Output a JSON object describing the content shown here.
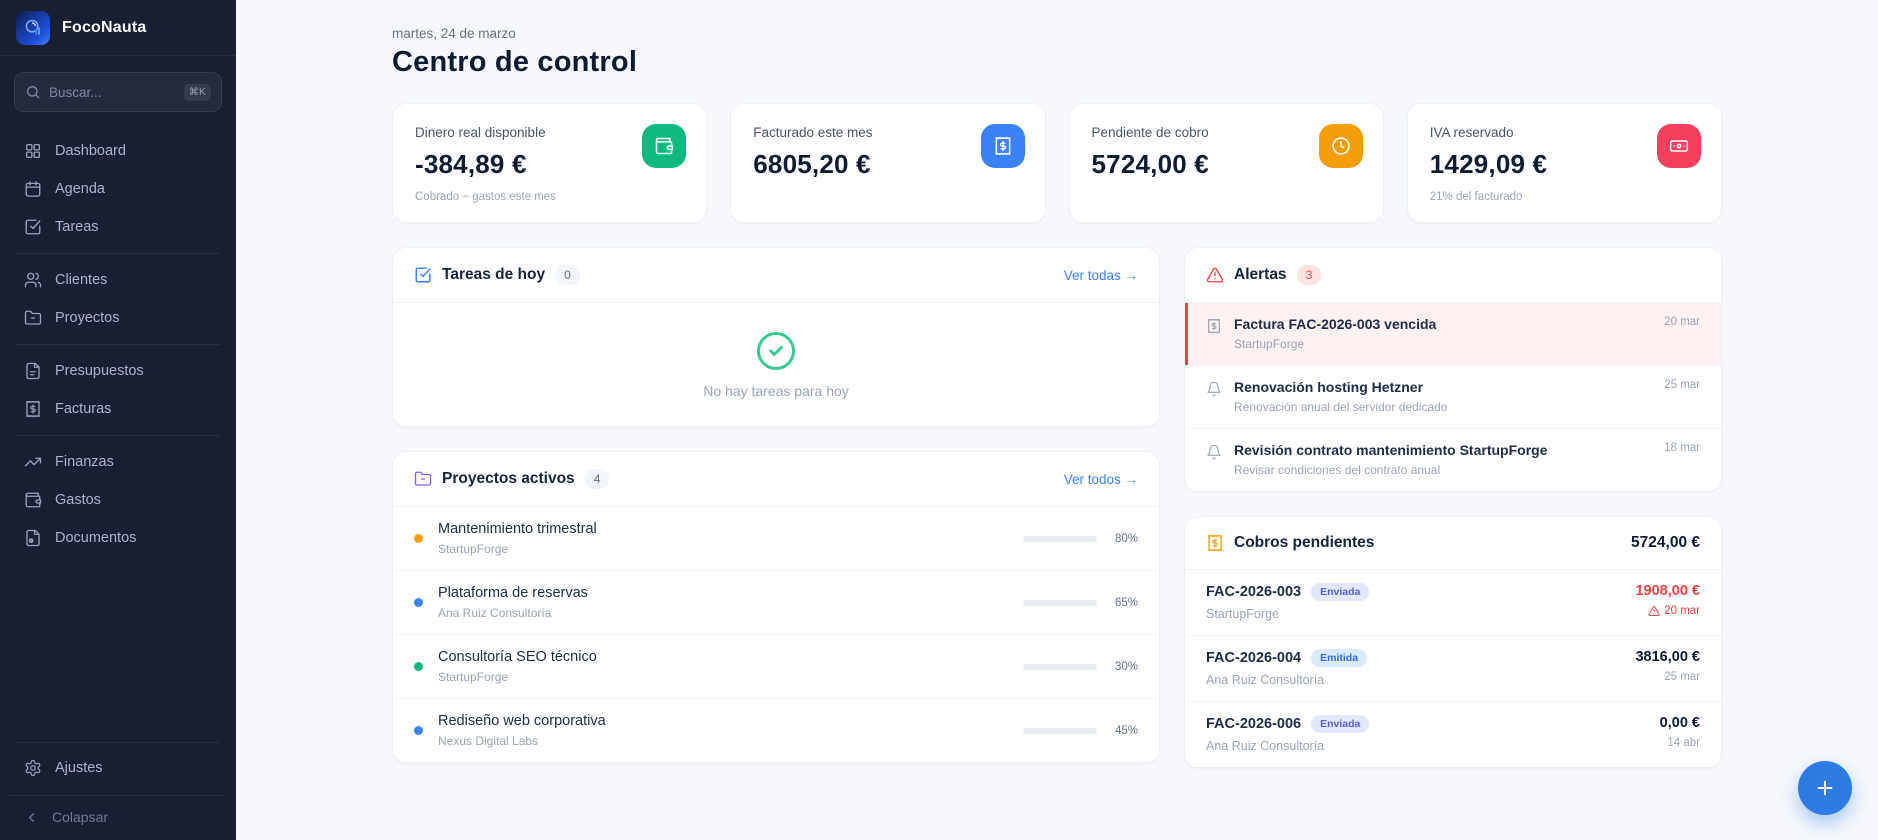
{
  "app": {
    "name": "FocoNauta"
  },
  "sidebar": {
    "search": {
      "placeholder": "Buscar...",
      "shortcut": "⌘K"
    },
    "items": [
      {
        "label": "Dashboard",
        "icon": "dashboard-icon"
      },
      {
        "label": "Agenda",
        "icon": "calendar-icon"
      },
      {
        "label": "Tareas",
        "icon": "check-square-icon"
      },
      {
        "label": "Clientes",
        "icon": "users-icon",
        "divider_before": true
      },
      {
        "label": "Proyectos",
        "icon": "folder-icon"
      },
      {
        "label": "Presupuestos",
        "icon": "file-text-icon",
        "divider_before": true
      },
      {
        "label": "Facturas",
        "icon": "receipt-icon"
      },
      {
        "label": "Finanzas",
        "icon": "trending-up-icon",
        "divider_before": true
      },
      {
        "label": "Gastos",
        "icon": "wallet-icon"
      },
      {
        "label": "Documentos",
        "icon": "document-icon"
      }
    ],
    "settings_label": "Ajustes",
    "collapse_label": "Colapsar"
  },
  "header": {
    "date": "martes, 24 de marzo",
    "title": "Centro de control"
  },
  "stats": [
    {
      "label": "Dinero real disponible",
      "value": "-384,89 €",
      "sub": "Cobrado − gastos este mes",
      "icon": "wallet-icon",
      "color": "#10b981"
    },
    {
      "label": "Facturado este mes",
      "value": "6805,20 €",
      "sub": "",
      "icon": "receipt-icon",
      "color": "#3b82f6"
    },
    {
      "label": "Pendiente de cobro",
      "value": "5724,00 €",
      "sub": "",
      "icon": "clock-icon",
      "color": "#f59e0b"
    },
    {
      "label": "IVA reservado",
      "value": "1429,09 €",
      "sub": "21% del facturado",
      "icon": "banknote-icon",
      "color": "#f43f5e"
    }
  ],
  "tasks": {
    "title": "Tareas de hoy",
    "count": "0",
    "link_label": "Ver todas →",
    "empty_text": "No hay tareas para hoy"
  },
  "projects": {
    "title": "Proyectos activos",
    "count": "4",
    "link_label": "Ver todos →",
    "items": [
      {
        "name": "Mantenimiento trimestral",
        "client": "StartupForge",
        "progress": 80,
        "progress_label": "80%",
        "dot_color": "#f59e0b"
      },
      {
        "name": "Plataforma de reservas",
        "client": "Ana Ruiz Consultoría",
        "progress": 65,
        "progress_label": "65%",
        "dot_color": "#3b82f6"
      },
      {
        "name": "Consultoría SEO técnico",
        "client": "StartupForge",
        "progress": 30,
        "progress_label": "30%",
        "dot_color": "#10b981"
      },
      {
        "name": "Rediseño web corporativa",
        "client": "Nexus Digital Labs",
        "progress": 45,
        "progress_label": "45%",
        "dot_color": "#3b82f6"
      }
    ]
  },
  "alerts": {
    "title": "Alertas",
    "count": "3",
    "items": [
      {
        "title": "Factura FAC-2026-003 vencida",
        "sub": "StartupForge",
        "date": "20 mar",
        "icon": "receipt-icon",
        "highlight": true
      },
      {
        "title": "Renovación hosting Hetzner",
        "sub": "Renovación anual del servidor dedicado",
        "date": "25 mar",
        "icon": "bell-icon"
      },
      {
        "title": "Revisión contrato mantenimiento StartupForge",
        "sub": "Revisar condiciones del contrato anual",
        "date": "18 mar",
        "icon": "bell-icon"
      }
    ]
  },
  "receivables": {
    "title": "Cobros pendientes",
    "total": "5724,00 €",
    "items": [
      {
        "code": "FAC-2026-003",
        "status": "Enviada",
        "status_variant": "sent",
        "client": "StartupForge",
        "amount": "1908,00 €",
        "due": "20 mar",
        "overdue": true
      },
      {
        "code": "FAC-2026-004",
        "status": "Emitida",
        "status_variant": "issued",
        "client": "Ana Ruiz Consultoría",
        "amount": "3816,00 €",
        "due": "25 mar",
        "overdue": false
      },
      {
        "code": "FAC-2026-006",
        "status": "Enviada",
        "status_variant": "sent",
        "client": "Ana Ruiz Consultoría",
        "amount": "0,00 €",
        "due": "14 abr",
        "overdue": false
      }
    ]
  },
  "fab": {
    "label": "add"
  },
  "colors": {
    "accent": "#3b82f6",
    "danger": "#ef4444",
    "success": "#10b981",
    "warning": "#f59e0b"
  }
}
